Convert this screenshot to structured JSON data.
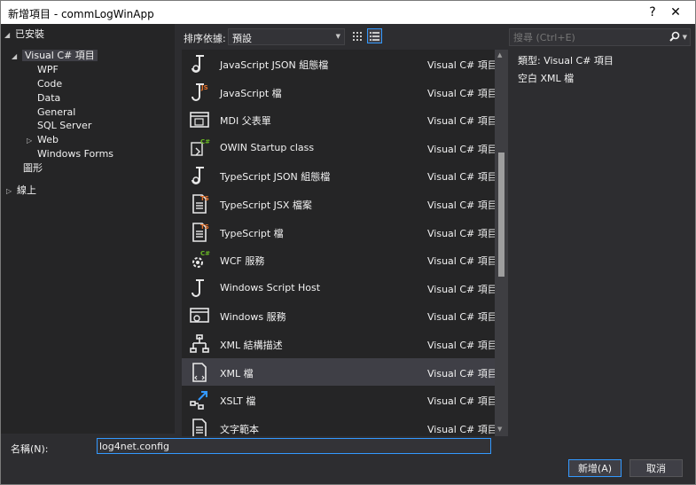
{
  "window": {
    "title": "新增項目 - commLogWinApp",
    "help": "?",
    "close": "✕"
  },
  "tree": {
    "installed": "已安裝",
    "visual_cs": "Visual C# 項目",
    "items": [
      "WPF",
      "Code",
      "Data",
      "General",
      "SQL Server",
      "Web",
      "Windows Forms"
    ],
    "graphics": "圖形",
    "online": "線上"
  },
  "toolbar": {
    "sort_label": "排序依據:",
    "sort_value": "預設"
  },
  "search": {
    "placeholder": "搜尋 (Ctrl+E)"
  },
  "list": {
    "items": [
      {
        "name": "JavaScript JSON 組態檔",
        "lang": "Visual C# 項目",
        "icon": "json-file-icon"
      },
      {
        "name": "JavaScript 檔",
        "lang": "Visual C# 項目",
        "icon": "js-file-icon"
      },
      {
        "name": "MDI 父表單",
        "lang": "Visual C# 項目",
        "icon": "mdi-form-icon"
      },
      {
        "name": "OWIN Startup class",
        "lang": "Visual C# 項目",
        "icon": "owin-icon"
      },
      {
        "name": "TypeScript JSON 組態檔",
        "lang": "Visual C# 項目",
        "icon": "json-file-icon"
      },
      {
        "name": "TypeScript JSX 檔案",
        "lang": "Visual C# 項目",
        "icon": "ts-file-icon"
      },
      {
        "name": "TypeScript 檔",
        "lang": "Visual C# 項目",
        "icon": "ts-file-icon"
      },
      {
        "name": "WCF 服務",
        "lang": "Visual C# 項目",
        "icon": "wcf-service-icon"
      },
      {
        "name": "Windows Script Host",
        "lang": "Visual C# 項目",
        "icon": "script-host-icon"
      },
      {
        "name": "Windows 服務",
        "lang": "Visual C# 項目",
        "icon": "windows-service-icon"
      },
      {
        "name": "XML 結構描述",
        "lang": "Visual C# 項目",
        "icon": "xml-schema-icon"
      },
      {
        "name": "XML 檔",
        "lang": "Visual C# 項目",
        "icon": "xml-file-icon"
      },
      {
        "name": "XSLT 檔",
        "lang": "Visual C# 項目",
        "icon": "xslt-file-icon"
      },
      {
        "name": "文字範本",
        "lang": "Visual C# 項目",
        "icon": "text-template-icon"
      }
    ]
  },
  "details": {
    "type_line": "類型:  Visual C# 項目",
    "desc": "空白 XML 檔"
  },
  "bottom": {
    "name_label": "名稱(N):",
    "name_value": "log4net.config",
    "add_button": "新增(A)",
    "cancel_button": "取消"
  },
  "colors": {
    "accent": "#3399ff",
    "ts_orange": "#e8722a",
    "cs_green": "#68b723",
    "bg": "#2d2d30"
  }
}
